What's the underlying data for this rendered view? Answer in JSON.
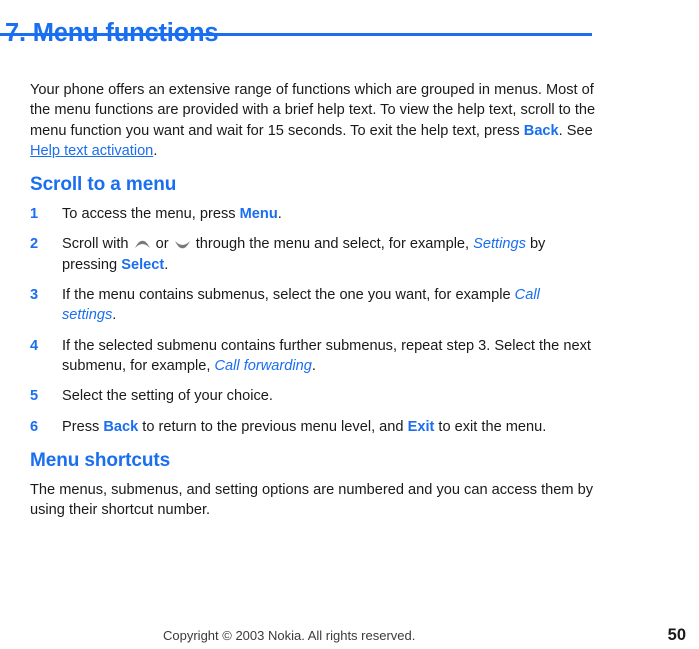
{
  "chapter": {
    "title": "7. Menu functions",
    "rule_color": "#1a6ef0"
  },
  "intro": {
    "part1": "Your phone offers an extensive range of functions which are grouped in menus. Most of the menu functions are provided with a brief help text. To view the help text, scroll to the menu function you want and wait for 15 seconds. To exit the help text, press ",
    "key_back": "Back",
    "part2": ". See ",
    "link_help_text_activation": "Help text activation",
    "part3": "."
  },
  "section_scroll": {
    "heading": "Scroll to a menu",
    "steps": [
      {
        "number": "1",
        "part1": "To access the menu, press ",
        "key1": "Menu",
        "part2": "."
      },
      {
        "number": "2",
        "part1": "Scroll with ",
        "icon_up": "scroll-up-arrow-icon",
        "part2": " or ",
        "icon_down": "scroll-down-arrow-icon",
        "part3": " through the menu and select, for example, ",
        "emphasis1": "Settings",
        "part4": " by pressing ",
        "key1": "Select",
        "part5": "."
      },
      {
        "number": "3",
        "part1": "If the menu contains submenus, select the one you want, for example ",
        "emphasis1": "Call settings",
        "part2": "."
      },
      {
        "number": "4",
        "part1": "If the selected submenu contains further submenus, repeat step 3. Select the next submenu, for example, ",
        "emphasis1": "Call forwarding",
        "part2": "."
      },
      {
        "number": "5",
        "part1": "Select the setting of your choice."
      },
      {
        "number": "6",
        "part1": "Press ",
        "key1": "Back",
        "part2": " to return to the previous menu level, and ",
        "key2": "Exit",
        "part3": " to exit the menu."
      }
    ]
  },
  "section_shortcuts": {
    "heading": "Menu shortcuts",
    "paragraph": "The menus, submenus, and setting options are numbered and you can access them by using their shortcut number."
  },
  "footer": {
    "copyright": "Copyright © 2003 Nokia. All rights reserved.",
    "page_number": "50"
  }
}
